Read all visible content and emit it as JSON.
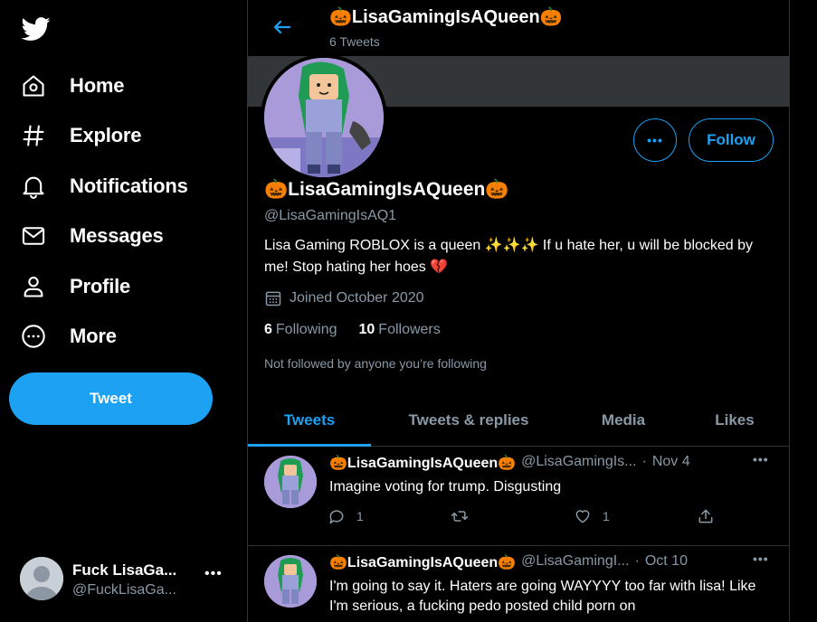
{
  "sidebar": {
    "logo": "twitter-bird-icon",
    "items": [
      {
        "label": "Home",
        "icon": "home-icon"
      },
      {
        "label": "Explore",
        "icon": "hashtag-icon"
      },
      {
        "label": "Notifications",
        "icon": "bell-icon"
      },
      {
        "label": "Messages",
        "icon": "envelope-icon"
      },
      {
        "label": "Profile",
        "icon": "person-icon"
      },
      {
        "label": "More",
        "icon": "more-circle-icon"
      }
    ],
    "tweet_button": "Tweet",
    "account": {
      "name": "Fuck LisaGa...",
      "handle": "@FuckLisaGa...",
      "more": "•••"
    }
  },
  "header": {
    "title": "🎃LisaGamingIsAQueen🎃",
    "tweet_count": "6 Tweets"
  },
  "profile": {
    "more_label": "•••",
    "follow_label": "Follow",
    "name": "🎃LisaGamingIsAQueen🎃",
    "handle": "@LisaGamingIsAQ1",
    "bio": "Lisa Gaming ROBLOX is a queen ✨✨✨ If u hate her, u will be blocked by me! Stop hating her hoes 💔",
    "joined": "Joined October 2020",
    "following_count": "6",
    "following_label": "Following",
    "followers_count": "10",
    "followers_label": "Followers",
    "not_followed": "Not followed by anyone you’re following"
  },
  "tabs": [
    {
      "label": "Tweets",
      "active": true
    },
    {
      "label": "Tweets & replies",
      "active": false
    },
    {
      "label": "Media",
      "active": false
    },
    {
      "label": "Likes",
      "active": false
    }
  ],
  "tweets": [
    {
      "name": "🎃LisaGamingIsAQueen🎃",
      "handle": "@LisaGamingIs...",
      "time": "Nov 4",
      "text": "Imagine voting for trump. Disgusting",
      "replies": "1",
      "retweets": "",
      "likes": "1",
      "more": "•••"
    },
    {
      "name": "🎃LisaGamingIsAQueen🎃",
      "handle": "@LisaGamingI...",
      "time": "Oct 10",
      "text": "I'm going to say it. Haters are going WAYYYY too far with lisa! Like I'm serious, a fucking pedo posted child porn on",
      "more": "•••"
    }
  ],
  "colors": {
    "accent": "#1da1f2",
    "background": "#000000",
    "secondary_text": "#8899a6",
    "divider": "#2f3336",
    "banner": "#333639"
  }
}
